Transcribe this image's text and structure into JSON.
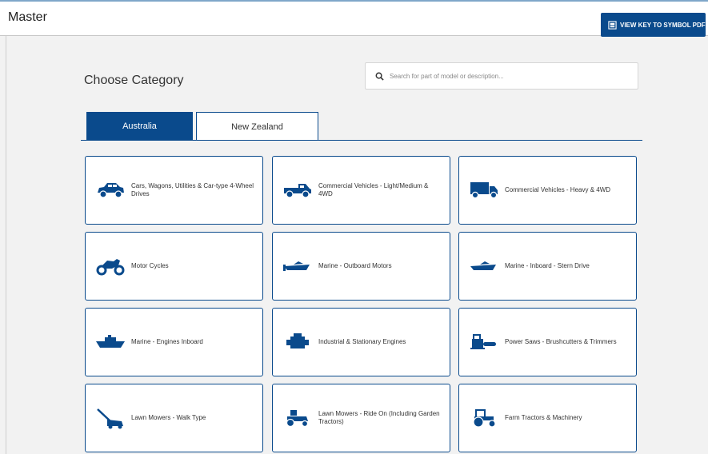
{
  "header": {
    "title": "Master",
    "pdf_button_label": "VIEW KEY TO SYMBOL PDF"
  },
  "main": {
    "heading": "Choose Category",
    "search_placeholder": "Search for part of model or description..."
  },
  "tabs": [
    {
      "label": "Australia",
      "active": true
    },
    {
      "label": "New Zealand",
      "active": false
    }
  ],
  "categories": [
    {
      "label": "Cars, Wagons, Utilities & Car-type 4-Wheel Drives",
      "icon": "car-icon"
    },
    {
      "label": "Commercial Vehicles - Light/Medium & 4WD",
      "icon": "pickup-truck-icon"
    },
    {
      "label": "Commercial Vehicles - Heavy & 4WD",
      "icon": "truck-icon"
    },
    {
      "label": "Motor Cycles",
      "icon": "motorcycle-icon"
    },
    {
      "label": "Marine - Outboard Motors",
      "icon": "speedboat-icon"
    },
    {
      "label": "Marine - Inboard - Stern Drive",
      "icon": "speedboat-icon"
    },
    {
      "label": "Marine - Engines Inboard",
      "icon": "ship-icon"
    },
    {
      "label": "Industrial & Stationary Engines",
      "icon": "engine-icon"
    },
    {
      "label": "Power Saws - Brushcutters & Trimmers",
      "icon": "chainsaw-icon"
    },
    {
      "label": "Lawn Mowers - Walk Type",
      "icon": "push-mower-icon"
    },
    {
      "label": "Lawn Mowers - Ride On (Including Garden Tractors)",
      "icon": "ride-on-mower-icon"
    },
    {
      "label": "Farm Tractors & Machinery",
      "icon": "tractor-icon"
    }
  ],
  "colors": {
    "primary": "#0a4a8c",
    "background": "#f2f2f2",
    "card_border": "#0a4a8c"
  }
}
